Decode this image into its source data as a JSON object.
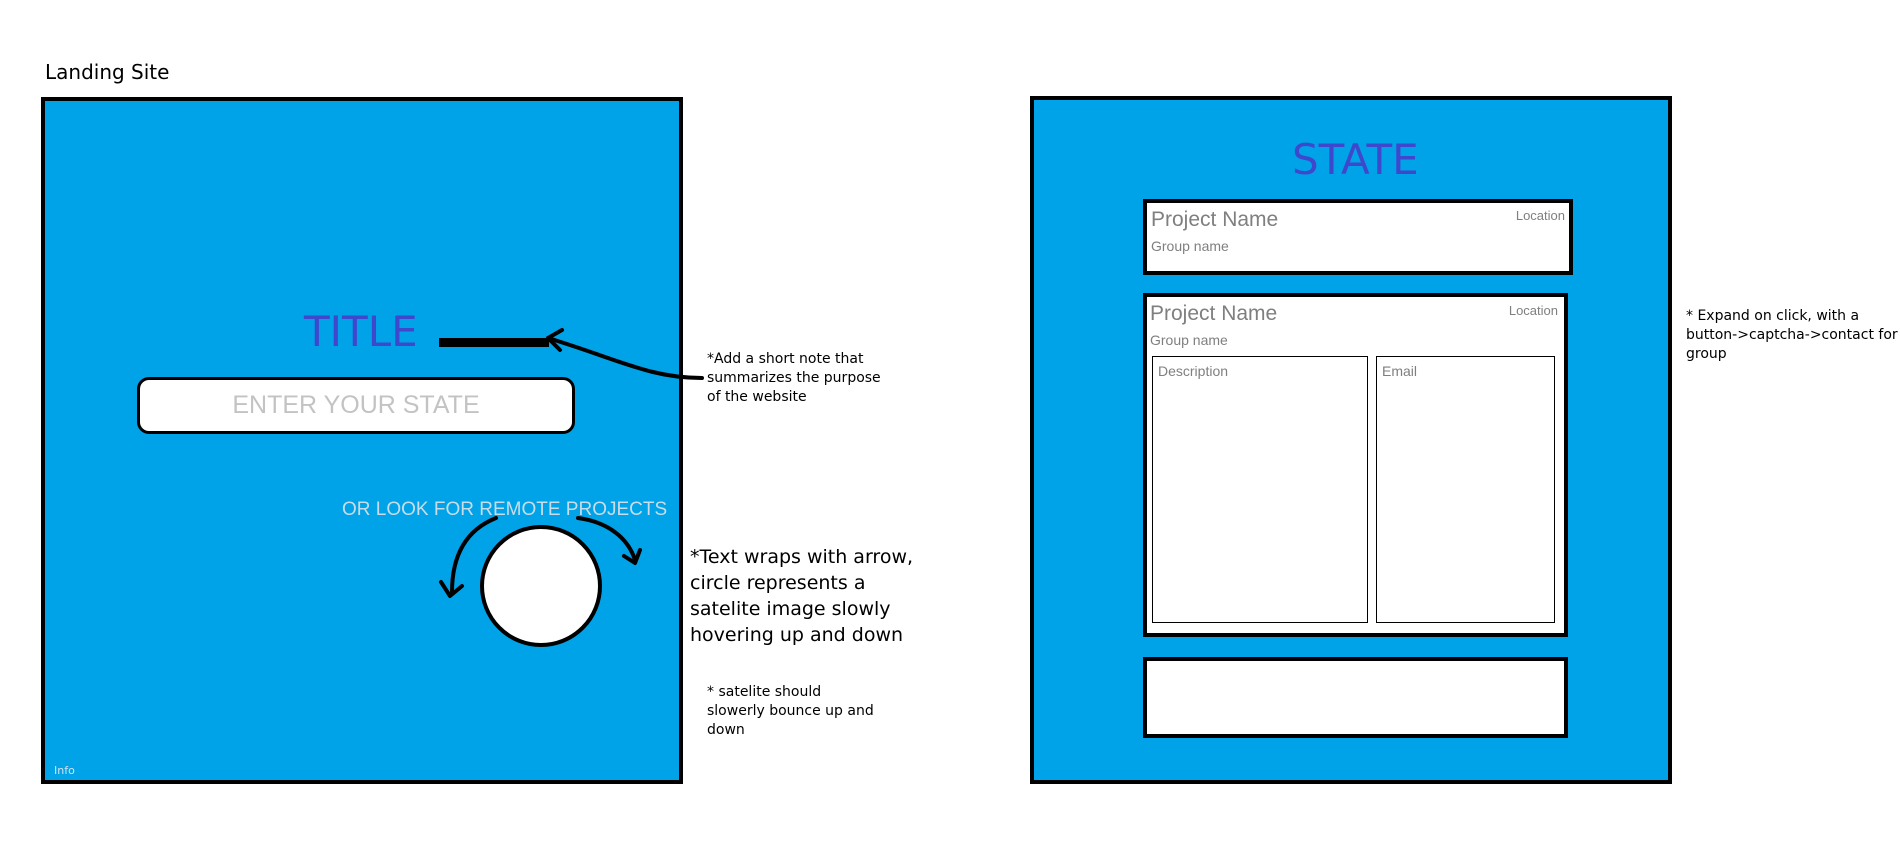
{
  "heading": "Landing Site",
  "landing": {
    "title": "TITLE",
    "state_placeholder": "ENTER YOUR STATE",
    "remote_link": "OR LOOK FOR REMOTE PROJECTS",
    "info_link": "Info"
  },
  "notes": {
    "title_note": [
      "*Add a short note that",
      "summarizes the purpose",
      "of the website"
    ],
    "wrap_note": [
      "*Text wraps with arrow,",
      "circle represents a",
      "satelite image slowly",
      "hovering up and down"
    ],
    "bounce_note": [
      "* satelite should",
      "slowerly bounce up and",
      "down"
    ],
    "expand_note": [
      "* Expand on click, with a",
      "button->captcha->contact for",
      "group"
    ]
  },
  "state_page": {
    "heading": "STATE",
    "cards": [
      {
        "project_name": "Project Name",
        "group_name": "Group name",
        "location": "Location"
      },
      {
        "project_name": "Project Name",
        "group_name": "Group name",
        "location": "Location",
        "description_label": "Description",
        "email_label": "Email"
      }
    ]
  },
  "colors": {
    "panel_bg": "#00a2e8",
    "title": "#3f48cc",
    "placeholder": "#c3c3c3",
    "card_text": "#7f7f7f"
  }
}
